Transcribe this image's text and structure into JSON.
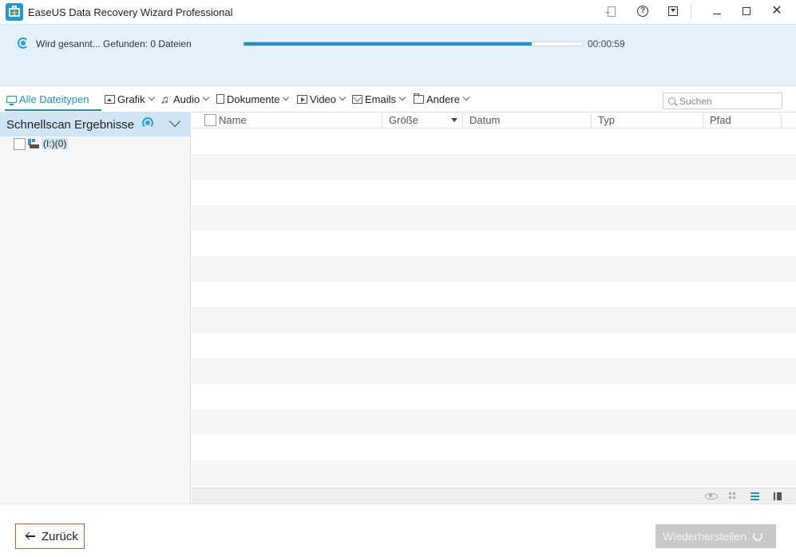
{
  "window": {
    "title": "EaseUS Data Recovery Wizard Professional"
  },
  "scan": {
    "status": "Wird gesannt... Gefunden: 0 Dateien",
    "progress_percent": 85,
    "elapsed": "00:00:59"
  },
  "filters": {
    "items": [
      {
        "label": "Alle Dateitypen",
        "icon": "monitor-icon"
      },
      {
        "label": "Grafik",
        "icon": "image-icon"
      },
      {
        "label": "Audio",
        "icon": "music-note-icon"
      },
      {
        "label": "Dokumente",
        "icon": "document-icon"
      },
      {
        "label": "Video",
        "icon": "video-icon"
      },
      {
        "label": "Emails",
        "icon": "mail-icon"
      },
      {
        "label": "Andere",
        "icon": "folder-icon"
      }
    ],
    "active": "Alle Dateitypen"
  },
  "search": {
    "placeholder": "Suchen",
    "value": ""
  },
  "tree": {
    "header": "Schnellscan Ergebnisse",
    "items": [
      {
        "label": "(I:)(0)",
        "icon": "drive-icon"
      }
    ]
  },
  "table": {
    "columns": [
      "Name",
      "Größe",
      "Datum",
      "Typ",
      "Pfad"
    ],
    "sorted_column": "Größe",
    "rows": []
  },
  "footer": {
    "back_label": "Zurück",
    "restore_label": "Wiederherstellen"
  },
  "colors": {
    "accent": "#1a93cc",
    "scan_panel_bg": "#e4f1fb",
    "back_border": "#c55a2f",
    "restore_disabled": "#c9c9c9"
  }
}
